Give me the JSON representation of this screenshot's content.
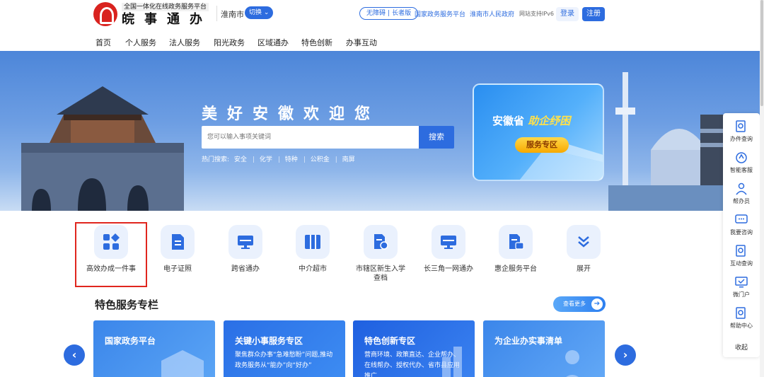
{
  "header": {
    "logo_sub": "全国一体化在线政务服务平台",
    "logo_main": "皖事通办",
    "city": "淮南市",
    "switch_label": "切换",
    "accessibility": "无障碍",
    "elder_mode": "长者版",
    "links": [
      "国家政务服务平台",
      "淮南市人民政府"
    ],
    "ipv6": "网站支持IPv6",
    "login": "登录",
    "register": "注册"
  },
  "nav": [
    "首页",
    "个人服务",
    "法人服务",
    "阳光政务",
    "区域通办",
    "特色创新",
    "办事互动"
  ],
  "banner": {
    "slogan": "美好安徽欢迎您",
    "search_placeholder": "您可以输入事项关键词",
    "search_button": "搜索",
    "hot_label": "热门搜索:",
    "hot_terms": [
      "安全",
      "化学",
      "特种",
      "公积金",
      "南屏"
    ],
    "card_title_a": "安徽省",
    "card_title_b": "助企纾困",
    "card_button": "服务专区"
  },
  "sidebar": {
    "items": [
      "办件查询",
      "智能客服",
      "帮办员",
      "我要咨询",
      "互动查询",
      "微门户",
      "帮助中心"
    ],
    "collapse": "收起"
  },
  "quick_icons": [
    {
      "label": "高效办成一件事",
      "icon": "grid-icon"
    },
    {
      "label": "电子证照",
      "icon": "document-icon"
    },
    {
      "label": "跨省通办",
      "icon": "monitor-icon"
    },
    {
      "label": "中介超市",
      "icon": "cabinet-icon"
    },
    {
      "label": "市辖区新生入学查档",
      "icon": "file-search-icon"
    },
    {
      "label": "长三角一网通办",
      "icon": "monitor-icon"
    },
    {
      "label": "惠企服务平台",
      "icon": "file-chat-icon"
    },
    {
      "label": "展开",
      "icon": "chevron-down-icon"
    }
  ],
  "featured": {
    "title": "特色服务专栏",
    "more": "查看更多",
    "cards": [
      {
        "title": "国家政务平台",
        "desc": ""
      },
      {
        "title": "关键小事服务专区",
        "desc": "聚焦群众办事“急难愁盼”问题,推动政务服务从“能办”向“好办”"
      },
      {
        "title": "特色创新专区",
        "desc": "营商环境、政策直达、企业帮办、在线帮办、授权代办、省市县应用推广"
      },
      {
        "title": "为企业办实事清单",
        "desc": ""
      }
    ]
  },
  "colors": {
    "primary": "#2d6cdf",
    "highlight": "#e0261e",
    "logo": "#d9231f"
  }
}
